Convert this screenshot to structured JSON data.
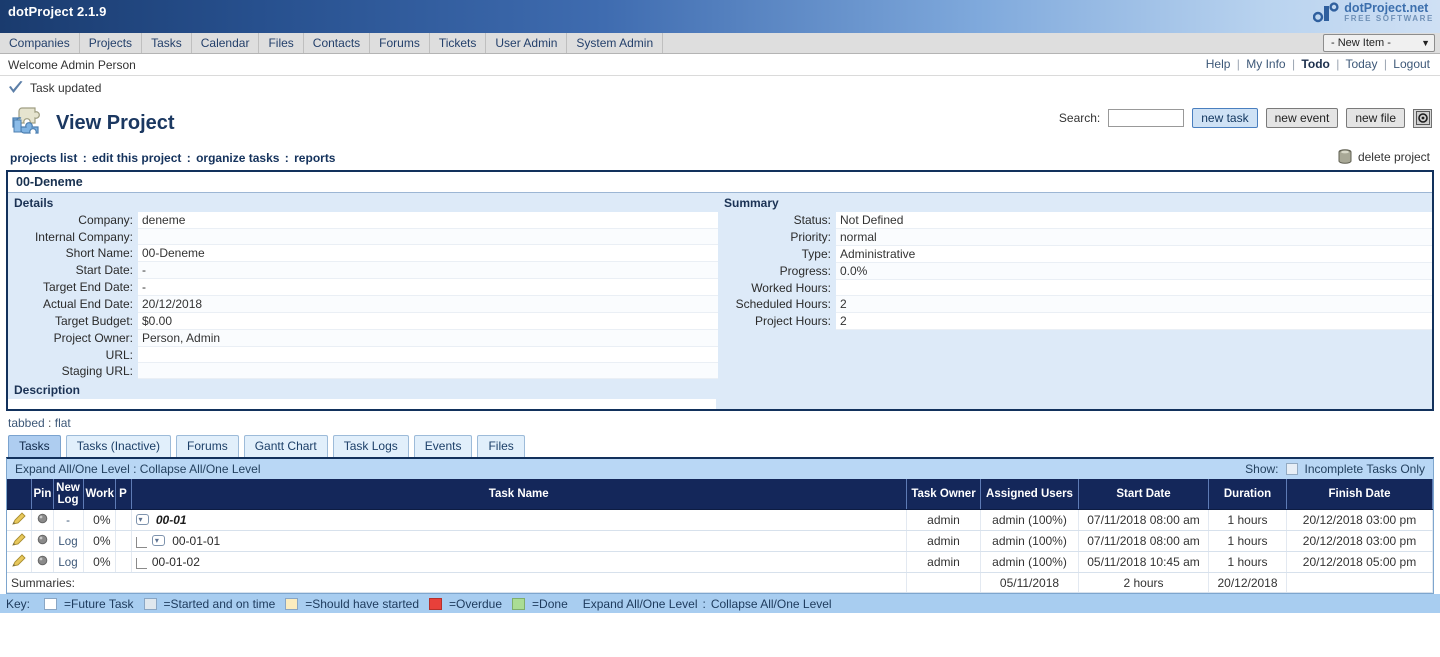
{
  "titlebar": {
    "app_title": "dotProject 2.1.9",
    "brand_line1": "dotProject.net",
    "brand_line2": "FREE SOFTWARE"
  },
  "menubar": {
    "items": [
      {
        "label": "Companies"
      },
      {
        "label": "Projects"
      },
      {
        "label": "Tasks"
      },
      {
        "label": "Calendar"
      },
      {
        "label": "Files"
      },
      {
        "label": "Contacts"
      },
      {
        "label": "Forums"
      },
      {
        "label": "Tickets"
      },
      {
        "label": "User Admin"
      },
      {
        "label": "System Admin"
      }
    ],
    "new_item_select": "- New Item -",
    "new_item_caret": "▼"
  },
  "welcome": {
    "text": "Welcome Admin Person",
    "links": [
      {
        "label": "Help",
        "bold": false
      },
      {
        "label": "My Info",
        "bold": false
      },
      {
        "label": "Todo",
        "bold": true
      },
      {
        "label": "Today",
        "bold": false
      },
      {
        "label": "Logout",
        "bold": false
      }
    ],
    "separator": "|"
  },
  "notice": {
    "icon": "check-icon",
    "text": "Task updated"
  },
  "page_header": {
    "icon": "puzzle-piece-icon",
    "title": "View Project",
    "search_label": "Search:",
    "search_value": "",
    "search_placeholder": "",
    "buttons": [
      {
        "label": "new task",
        "focused": true
      },
      {
        "label": "new event",
        "focused": false
      },
      {
        "label": "new file",
        "focused": false
      }
    ],
    "magnifier_icon": "search-target-icon"
  },
  "crumbs": {
    "items": [
      "projects list",
      "edit this project",
      "organize tasks",
      "reports"
    ],
    "separator": ":",
    "delete_label": "delete project",
    "delete_icon": "trash-icon"
  },
  "project": {
    "name": "00-Deneme",
    "details_heading": "Details",
    "details": [
      {
        "key": "Company:",
        "value": "deneme"
      },
      {
        "key": "Internal Company:",
        "value": ""
      },
      {
        "key": "Short Name:",
        "value": "00-Deneme"
      },
      {
        "key": "Start Date:",
        "value": "-"
      },
      {
        "key": "Target End Date:",
        "value": "-"
      },
      {
        "key": "Actual End Date:",
        "value": "20/12/2018"
      },
      {
        "key": "Target Budget:",
        "value": "$0.00"
      },
      {
        "key": "Project Owner:",
        "value": "Person, Admin"
      },
      {
        "key": "URL:",
        "value": ""
      },
      {
        "key": "Staging URL:",
        "value": ""
      }
    ],
    "summary_heading": "Summary",
    "summary": [
      {
        "key": "Status:",
        "value": "Not Defined"
      },
      {
        "key": "Priority:",
        "value": "normal"
      },
      {
        "key": "Type:",
        "value": "Administrative"
      },
      {
        "key": "Progress:",
        "value": "0.0%"
      },
      {
        "key": "Worked Hours:",
        "value": ""
      },
      {
        "key": "Scheduled Hours:",
        "value": "2"
      },
      {
        "key": "Project Hours:",
        "value": "2"
      }
    ],
    "description_heading": "Description",
    "description_text": ""
  },
  "viewmode": {
    "tabbed": "tabbed",
    "separator": ":",
    "flat": "flat"
  },
  "tabs": [
    {
      "label": "Tasks",
      "active": true
    },
    {
      "label": "Tasks (Inactive)",
      "active": false
    },
    {
      "label": "Forums",
      "active": false
    },
    {
      "label": "Gantt Chart",
      "active": false
    },
    {
      "label": "Task Logs",
      "active": false
    },
    {
      "label": "Events",
      "active": false
    },
    {
      "label": "Files",
      "active": false
    }
  ],
  "task_panel": {
    "expand_all": "Expand All/One Level",
    "expand_sep": ":",
    "collapse_all": "Collapse All/One Level",
    "show_label": "Show:",
    "incomplete_label": "Incomplete Tasks Only",
    "incomplete_checked": false,
    "columns": [
      {
        "label": ""
      },
      {
        "label": "Pin"
      },
      {
        "label": "New Log"
      },
      {
        "label": "Work"
      },
      {
        "label": "P"
      },
      {
        "label": "Task Name"
      },
      {
        "label": "Task Owner"
      },
      {
        "label": "Assigned Users"
      },
      {
        "label": "Start Date"
      },
      {
        "label": "Duration"
      },
      {
        "label": "Finish Date"
      }
    ],
    "rows": [
      {
        "edit_icon": "pencil-icon",
        "pin_icon": "pin-icon",
        "new_log": "-",
        "work": "0%",
        "p": "",
        "name": "00-01",
        "indent": 0,
        "has_toggle": true,
        "bold": true,
        "owner": "admin",
        "assigned": "admin (100%)",
        "start": "07/11/2018 08:00 am",
        "duration": "1 hours",
        "finish": "20/12/2018 03:00 pm",
        "highlight": false
      },
      {
        "edit_icon": "pencil-icon",
        "pin_icon": "pin-icon",
        "new_log": "Log",
        "work": "0%",
        "p": "",
        "name": "00-01-01",
        "indent": 1,
        "has_toggle": true,
        "bold": false,
        "owner": "admin",
        "assigned": "admin (100%)",
        "start": "07/11/2018 08:00 am",
        "duration": "1 hours",
        "finish": "20/12/2018 03:00 pm",
        "highlight": false
      },
      {
        "edit_icon": "pencil-icon",
        "pin_icon": "pin-icon",
        "new_log": "Log",
        "work": "0%",
        "p": "",
        "name": "00-01-02",
        "indent": 2,
        "has_toggle": false,
        "bold": false,
        "owner": "admin",
        "assigned": "admin (100%)",
        "start": "05/11/2018 10:45 am",
        "duration": "1 hours",
        "finish": "20/12/2018 05:00 pm",
        "highlight": true
      }
    ],
    "summaries": {
      "label": "Summaries:",
      "start": "05/11/2018",
      "duration": "2 hours",
      "finish": "20/12/2018"
    },
    "key": {
      "label": "Key:",
      "entries": [
        {
          "label": "=Future Task",
          "color": "#ffffff"
        },
        {
          "label": "=Started and on time",
          "color": "#dfe7ee"
        },
        {
          "label": "=Should have started",
          "color": "#fbecbf"
        },
        {
          "label": "=Overdue",
          "color": "#e8403a"
        },
        {
          "label": "=Done",
          "color": "#aadd94"
        }
      ],
      "expand_all": "Expand All/One Level",
      "sep": ":",
      "collapse_all": "Collapse All/One Level"
    }
  }
}
